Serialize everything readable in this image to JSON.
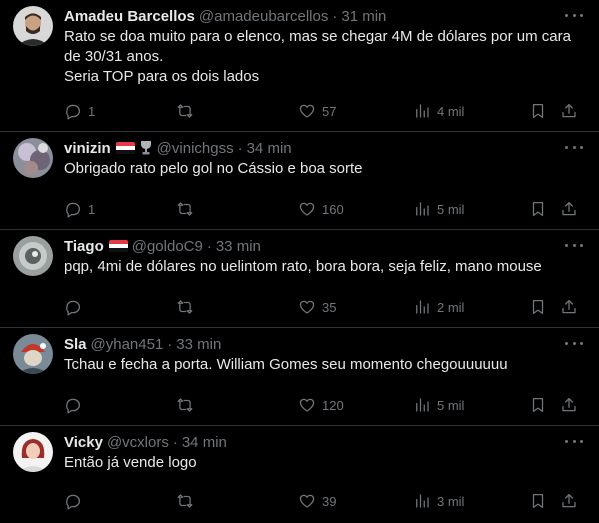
{
  "tweets": [
    {
      "name": "Amadeu Barcellos",
      "handle": "@amadeubarcellos",
      "sep": "·",
      "time": "31 min",
      "text_lines": [
        "Rato se doa muito para o elenco, mas se chegar 4M de dólares por um cara",
        "de 30/31 anos.",
        "Seria TOP para os dois lados"
      ],
      "replies": "1",
      "retweets": "",
      "likes": "57",
      "views": "4 mil"
    },
    {
      "name": "vinizin",
      "handle": "@vinichgss",
      "sep": "·",
      "time": "34 min",
      "text_lines": [
        "Obrigado rato pelo gol no Cássio e boa sorte"
      ],
      "replies": "1",
      "retweets": "",
      "likes": "160",
      "views": "5 mil"
    },
    {
      "name": "Tiago",
      "handle": "@goldoC9",
      "sep": "·",
      "time": "33 min",
      "text_lines": [
        "pqp, 4mi de dólares no uelintom rato, bora bora, seja feliz, mano mouse"
      ],
      "replies": "",
      "retweets": "",
      "likes": "35",
      "views": "2 mil"
    },
    {
      "name": "Sla",
      "handle": "@yhan451",
      "sep": "·",
      "time": "33 min",
      "text_lines": [
        "Tchau e fecha a porta. William Gomes seu momento chegouuuuuu"
      ],
      "replies": "",
      "retweets": "",
      "likes": "120",
      "views": "5 mil"
    },
    {
      "name": "Vicky",
      "handle": "@vcxlors",
      "sep": "·",
      "time": "34 min",
      "text_lines": [
        "Então já vende logo"
      ],
      "replies": "",
      "retweets": "",
      "likes": "39",
      "views": "3 mil"
    }
  ],
  "colors": {
    "background": "#000000",
    "text": "#e7e9ea",
    "muted": "#71767b",
    "divider": "#2f3336",
    "flag_red": "#e63946"
  },
  "icons": [
    "reply-icon",
    "retweet-icon",
    "like-icon",
    "views-icon",
    "bookmark-icon",
    "share-icon",
    "more-icon"
  ]
}
